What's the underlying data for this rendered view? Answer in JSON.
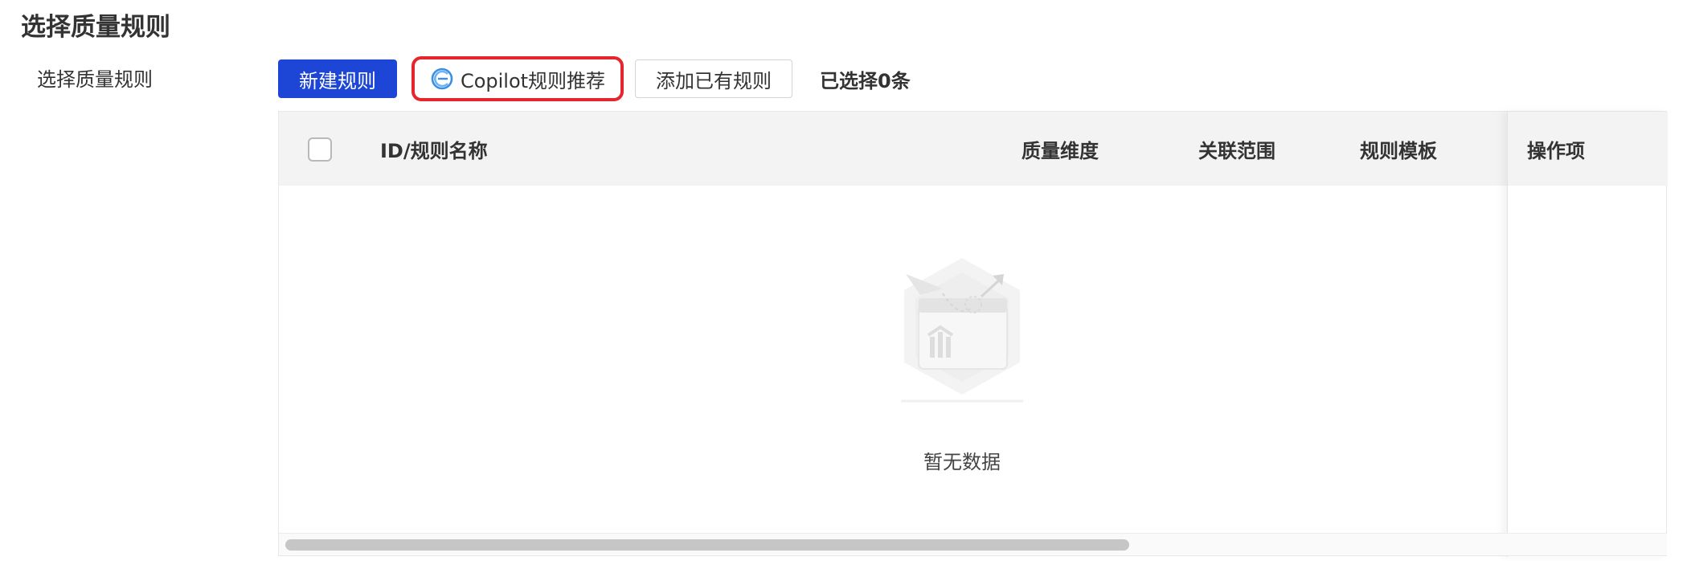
{
  "page": {
    "title": "选择质量规则"
  },
  "form": {
    "label": "选择质量规则"
  },
  "toolbar": {
    "new_rule_label": "新建规则",
    "copilot_label": "Copilot规则推荐",
    "add_existing_label": "添加已有规则",
    "selected_count_text": "已选择0条"
  },
  "table": {
    "columns": [
      "ID/规则名称",
      "质量维度",
      "关联范围",
      "规则模板",
      "操作项"
    ],
    "rows": [],
    "empty_text": "暂无数据"
  },
  "colors": {
    "primary": "#1d46d6",
    "highlight_border": "#e5262c",
    "header_bg": "#f3f3f3"
  },
  "icons": {
    "copilot": "copilot-icon",
    "empty": "empty-data-illustration"
  }
}
